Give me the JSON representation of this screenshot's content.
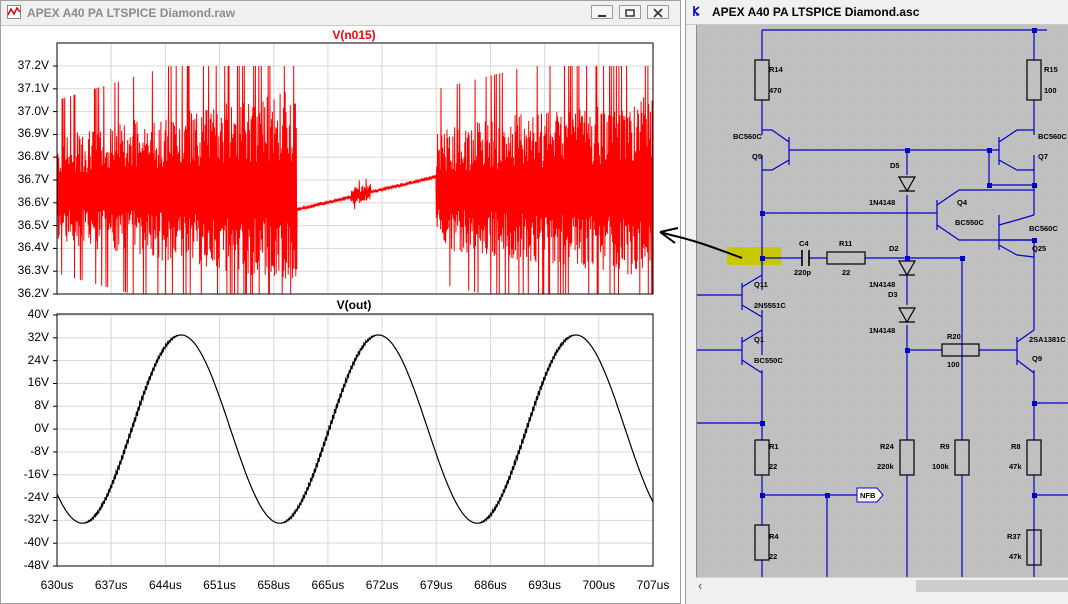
{
  "waveform_window": {
    "title": "APEX A40 PA LTSPICE Diamond.raw",
    "top_pane": {
      "trace_label": "V(n015)",
      "trace_color": "#ff0000",
      "y_ticks": [
        "37.2V",
        "37.1V",
        "37.0V",
        "36.9V",
        "36.8V",
        "36.7V",
        "36.6V",
        "36.5V",
        "36.4V",
        "36.3V",
        "36.2V"
      ]
    },
    "bottom_pane": {
      "trace_label": "V(out)",
      "trace_color": "#000000",
      "y_ticks": [
        "40V",
        "32V",
        "24V",
        "16V",
        "8V",
        "0V",
        "-8V",
        "-16V",
        "-24V",
        "-32V",
        "-40V",
        "-48V"
      ]
    },
    "x_ticks": [
      "630us",
      "637us",
      "644us",
      "651us",
      "658us",
      "665us",
      "672us",
      "679us",
      "686us",
      "693us",
      "700us",
      "707us"
    ]
  },
  "schematic_window": {
    "title": "APEX A40 PA LTSPICE Diamond.asc",
    "wire_color": "#0000cc",
    "highlight_color": "#c8c800",
    "components": {
      "r14": {
        "ref": "R14",
        "value": "470"
      },
      "r15": {
        "ref": "R15",
        "value": "100"
      },
      "q5": {
        "ref": "Q5",
        "model": "BC560C"
      },
      "q7": {
        "ref": "Q7",
        "model": "BC560C"
      },
      "d5": {
        "ref": "D5",
        "model": "1N4148"
      },
      "q4": {
        "ref": "Q4",
        "model": "BC550C"
      },
      "q25": {
        "ref": "Q25",
        "model": "BC560C"
      },
      "c4": {
        "ref": "C4",
        "value": "220p"
      },
      "r11": {
        "ref": "R11",
        "value": "22"
      },
      "d2": {
        "ref": "D2",
        "model": "1N4148"
      },
      "d3": {
        "ref": "D3",
        "model": "1N4148"
      },
      "q11": {
        "ref": "Q11",
        "model": "2N5551C"
      },
      "q1": {
        "ref": "Q1",
        "model": "BC550C"
      },
      "r20": {
        "ref": "R20",
        "value": "100"
      },
      "q9": {
        "ref": "Q9",
        "model": "2SA1381C"
      },
      "r1": {
        "ref": "R1",
        "value": "22"
      },
      "r24": {
        "ref": "R24",
        "value": "220k"
      },
      "r9": {
        "ref": "R9",
        "value": "100k"
      },
      "r8": {
        "ref": "R8",
        "value": "47k"
      },
      "r4": {
        "ref": "R4",
        "value": "22"
      },
      "r37": {
        "ref": "R37",
        "value": "47k"
      },
      "nfb": {
        "label": "NFB"
      }
    }
  }
}
